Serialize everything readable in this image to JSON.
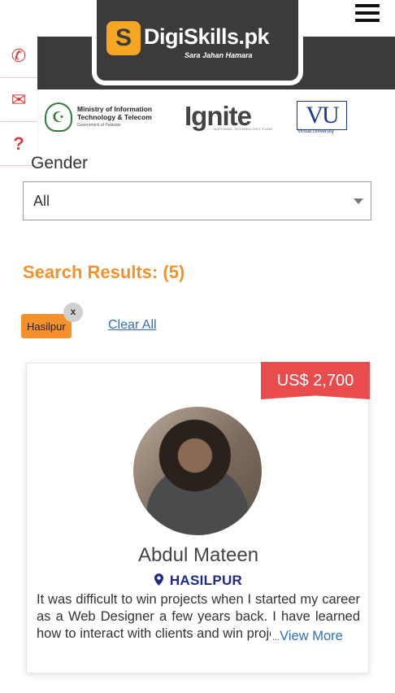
{
  "header": {
    "logo_mark": "S",
    "logo_text": "DigiSkills.pk",
    "logo_tagline": "Sara Jahan Hamara",
    "menu_icon": "hamburger-menu-icon"
  },
  "side_contacts": [
    {
      "name": "phone-icon",
      "glyph": "✆"
    },
    {
      "name": "mail-icon",
      "glyph": "✉"
    },
    {
      "name": "help-icon",
      "glyph": "?"
    }
  ],
  "partners": {
    "moit_line1": "Ministry of Information",
    "moit_line2": "Technology & Telecom",
    "moit_line3": "Government of Pakistan",
    "ignite": "Ignite",
    "ignite_sub": "NATIONAL TECHNOLOGY FUND",
    "vu": "VU",
    "vu_sub": "Virtual University"
  },
  "filters": {
    "gender_label": "Gender",
    "gender_value": "All"
  },
  "results": {
    "title": "Search Results: (5)",
    "active_tag": "Hasilpur",
    "remove_tag": "x",
    "clear_all": "Clear All"
  },
  "card": {
    "price": "US$ 2,700",
    "name": "Abdul Mateen",
    "location": "HASILPUR",
    "testimonial": "It was difficult to win projects when I started my career as a Web Designer a few years back. I have learned how to interact with clients and win projects",
    "view_more_dots": "...",
    "view_more": "View More"
  },
  "colors": {
    "accent": "#f4912b",
    "price_ribbon": "#e94c4c",
    "header_dark": "#3b3b3b",
    "location_blue": "#1c2a8c",
    "link_blue": "#2f6fb5"
  }
}
